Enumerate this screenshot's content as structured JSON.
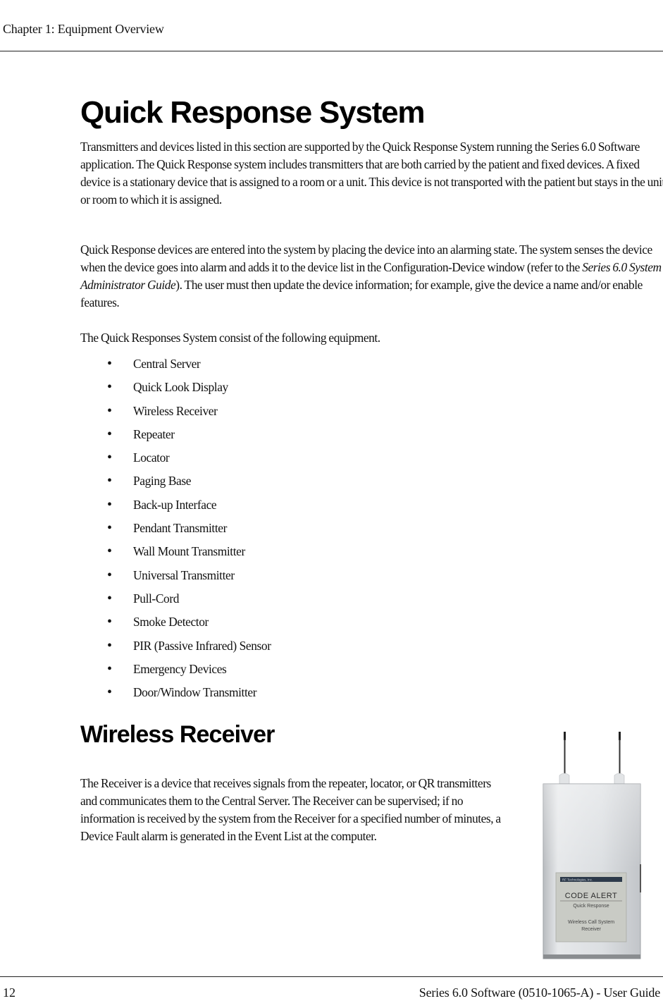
{
  "header": {
    "chapter": "Chapter 1: Equipment Overview"
  },
  "section1": {
    "title": "Quick Response System",
    "p1": "Transmitters and devices listed in this section are supported by the Quick Response System running the Series 6.0 Software application. The Quick Response system includes transmitters that are both carried by the patient and fixed devices. A fixed device is a stationary device that is assigned to a room or a unit. This device is not transported with the patient but stays in the unit or room to which it is assigned.",
    "p2_before": "Quick Response devices are entered into the system by placing the device into an alarming state. The system senses the device when the device goes into alarm and adds it to the device list in the Configuration-Device window (refer to the ",
    "p2_italic": "Series 6.0 System Administrator Guide",
    "p2_after": "). The user must then update the device information; for example, give the device a name and/or enable features.",
    "p3": "The Quick Responses System consist of the following equipment.",
    "bullet_glyph": "•",
    "equipment": [
      "Central Server",
      "Quick Look Display",
      "Wireless Receiver",
      "Repeater",
      "Locator",
      "Paging Base",
      "Back-up Interface",
      "Pendant Transmitter",
      "Wall Mount Transmitter",
      "Universal Transmitter",
      "Pull-Cord",
      "Smoke Detector",
      "PIR (Passive Infrared) Sensor",
      "Emergency Devices",
      "Door/Window Transmitter"
    ]
  },
  "section2": {
    "title": "Wireless Receiver",
    "p1": "The Receiver is a device that receives signals from the repeater, locator, or QR transmitters and communicates them to the Central Server. The Receiver can be supervised; if no information is received by the system from the Receiver for a specified number of minutes, a Device Fault alarm is generated in the Event List at the computer.",
    "device_image": {
      "label_company": "RF Technologies, Inc.",
      "label_brand": "CODE ALERT",
      "label_product": "Quick Response",
      "label_line1": "Wireless Call System",
      "label_line2": "Receiver"
    }
  },
  "footer": {
    "page_number": "12",
    "document_title": "Series 6.0 Software (0510-1065-A) - User Guide"
  }
}
